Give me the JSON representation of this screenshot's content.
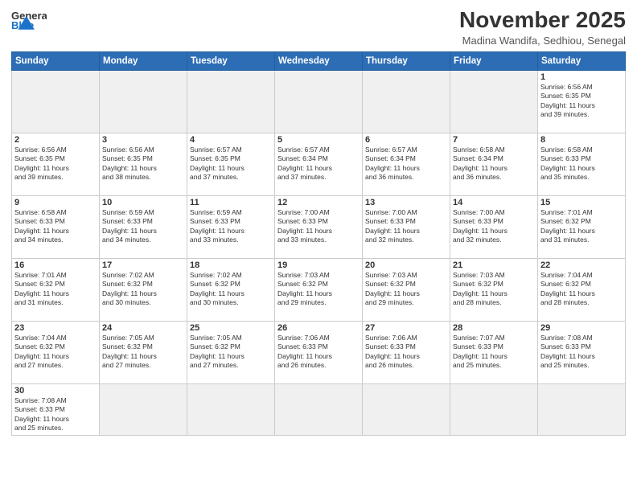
{
  "header": {
    "logo_general": "General",
    "logo_blue": "Blue",
    "month_title": "November 2025",
    "location": "Madina Wandifa, Sedhiou, Senegal"
  },
  "weekdays": [
    "Sunday",
    "Monday",
    "Tuesday",
    "Wednesday",
    "Thursday",
    "Friday",
    "Saturday"
  ],
  "weeks": [
    [
      {
        "day": "",
        "info": ""
      },
      {
        "day": "",
        "info": ""
      },
      {
        "day": "",
        "info": ""
      },
      {
        "day": "",
        "info": ""
      },
      {
        "day": "",
        "info": ""
      },
      {
        "day": "",
        "info": ""
      },
      {
        "day": "1",
        "info": "Sunrise: 6:56 AM\nSunset: 6:35 PM\nDaylight: 11 hours\nand 39 minutes."
      }
    ],
    [
      {
        "day": "2",
        "info": "Sunrise: 6:56 AM\nSunset: 6:35 PM\nDaylight: 11 hours\nand 39 minutes."
      },
      {
        "day": "3",
        "info": "Sunrise: 6:56 AM\nSunset: 6:35 PM\nDaylight: 11 hours\nand 38 minutes."
      },
      {
        "day": "4",
        "info": "Sunrise: 6:57 AM\nSunset: 6:35 PM\nDaylight: 11 hours\nand 37 minutes."
      },
      {
        "day": "5",
        "info": "Sunrise: 6:57 AM\nSunset: 6:34 PM\nDaylight: 11 hours\nand 37 minutes."
      },
      {
        "day": "6",
        "info": "Sunrise: 6:57 AM\nSunset: 6:34 PM\nDaylight: 11 hours\nand 36 minutes."
      },
      {
        "day": "7",
        "info": "Sunrise: 6:58 AM\nSunset: 6:34 PM\nDaylight: 11 hours\nand 36 minutes."
      },
      {
        "day": "8",
        "info": "Sunrise: 6:58 AM\nSunset: 6:33 PM\nDaylight: 11 hours\nand 35 minutes."
      }
    ],
    [
      {
        "day": "9",
        "info": "Sunrise: 6:58 AM\nSunset: 6:33 PM\nDaylight: 11 hours\nand 34 minutes."
      },
      {
        "day": "10",
        "info": "Sunrise: 6:59 AM\nSunset: 6:33 PM\nDaylight: 11 hours\nand 34 minutes."
      },
      {
        "day": "11",
        "info": "Sunrise: 6:59 AM\nSunset: 6:33 PM\nDaylight: 11 hours\nand 33 minutes."
      },
      {
        "day": "12",
        "info": "Sunrise: 7:00 AM\nSunset: 6:33 PM\nDaylight: 11 hours\nand 33 minutes."
      },
      {
        "day": "13",
        "info": "Sunrise: 7:00 AM\nSunset: 6:33 PM\nDaylight: 11 hours\nand 32 minutes."
      },
      {
        "day": "14",
        "info": "Sunrise: 7:00 AM\nSunset: 6:33 PM\nDaylight: 11 hours\nand 32 minutes."
      },
      {
        "day": "15",
        "info": "Sunrise: 7:01 AM\nSunset: 6:32 PM\nDaylight: 11 hours\nand 31 minutes."
      }
    ],
    [
      {
        "day": "16",
        "info": "Sunrise: 7:01 AM\nSunset: 6:32 PM\nDaylight: 11 hours\nand 31 minutes."
      },
      {
        "day": "17",
        "info": "Sunrise: 7:02 AM\nSunset: 6:32 PM\nDaylight: 11 hours\nand 30 minutes."
      },
      {
        "day": "18",
        "info": "Sunrise: 7:02 AM\nSunset: 6:32 PM\nDaylight: 11 hours\nand 30 minutes."
      },
      {
        "day": "19",
        "info": "Sunrise: 7:03 AM\nSunset: 6:32 PM\nDaylight: 11 hours\nand 29 minutes."
      },
      {
        "day": "20",
        "info": "Sunrise: 7:03 AM\nSunset: 6:32 PM\nDaylight: 11 hours\nand 29 minutes."
      },
      {
        "day": "21",
        "info": "Sunrise: 7:03 AM\nSunset: 6:32 PM\nDaylight: 11 hours\nand 28 minutes."
      },
      {
        "day": "22",
        "info": "Sunrise: 7:04 AM\nSunset: 6:32 PM\nDaylight: 11 hours\nand 28 minutes."
      }
    ],
    [
      {
        "day": "23",
        "info": "Sunrise: 7:04 AM\nSunset: 6:32 PM\nDaylight: 11 hours\nand 27 minutes."
      },
      {
        "day": "24",
        "info": "Sunrise: 7:05 AM\nSunset: 6:32 PM\nDaylight: 11 hours\nand 27 minutes."
      },
      {
        "day": "25",
        "info": "Sunrise: 7:05 AM\nSunset: 6:32 PM\nDaylight: 11 hours\nand 27 minutes."
      },
      {
        "day": "26",
        "info": "Sunrise: 7:06 AM\nSunset: 6:33 PM\nDaylight: 11 hours\nand 26 minutes."
      },
      {
        "day": "27",
        "info": "Sunrise: 7:06 AM\nSunset: 6:33 PM\nDaylight: 11 hours\nand 26 minutes."
      },
      {
        "day": "28",
        "info": "Sunrise: 7:07 AM\nSunset: 6:33 PM\nDaylight: 11 hours\nand 25 minutes."
      },
      {
        "day": "29",
        "info": "Sunrise: 7:08 AM\nSunset: 6:33 PM\nDaylight: 11 hours\nand 25 minutes."
      }
    ],
    [
      {
        "day": "30",
        "info": "Sunrise: 7:08 AM\nSunset: 6:33 PM\nDaylight: 11 hours\nand 25 minutes."
      },
      {
        "day": "",
        "info": ""
      },
      {
        "day": "",
        "info": ""
      },
      {
        "day": "",
        "info": ""
      },
      {
        "day": "",
        "info": ""
      },
      {
        "day": "",
        "info": ""
      },
      {
        "day": "",
        "info": ""
      }
    ]
  ]
}
